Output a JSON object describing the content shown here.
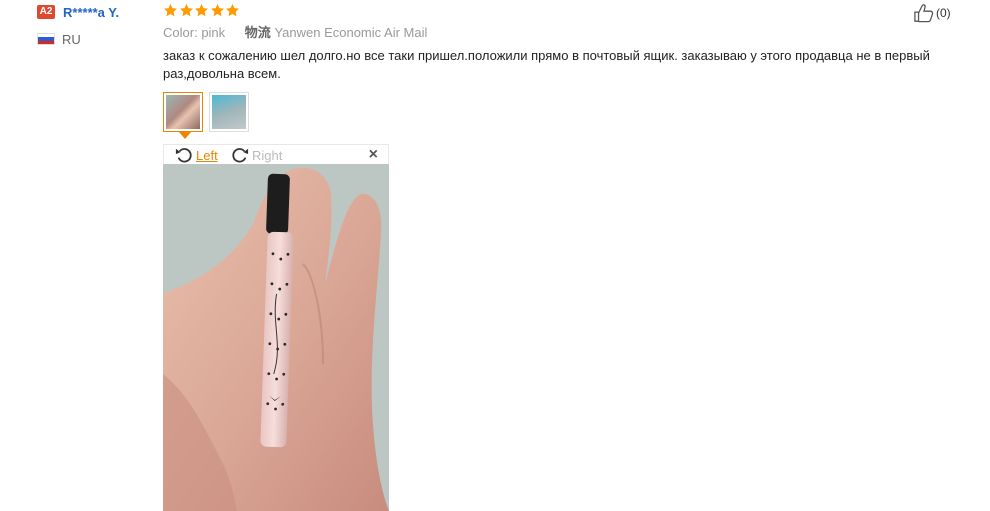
{
  "user": {
    "level": "A2",
    "name": "R*****a Y.",
    "country": "RU"
  },
  "review": {
    "rating": 5,
    "color_label": "Color:",
    "color_value": "pink",
    "shipping_label": "物流",
    "shipping_value": "Yanwen Economic Air Mail",
    "text": "заказ к сожалению шел долго.но все таки пришел.положили прямо в почтовый ящик. заказываю у этого продавца не в первый раз,довольна всем."
  },
  "viewer": {
    "rotate_left": "Left",
    "rotate_right": "Right",
    "close": "×"
  },
  "likes": {
    "count": "(0)"
  },
  "colors": {
    "star": "#ff9a00",
    "accent": "#ef8300",
    "username": "#2365c2",
    "badge": "#e0482f"
  },
  "icons": [
    "star-icon",
    "rotate-left-icon",
    "rotate-right-icon",
    "close-icon",
    "thumbs-up-icon",
    "flag-ru-icon"
  ]
}
